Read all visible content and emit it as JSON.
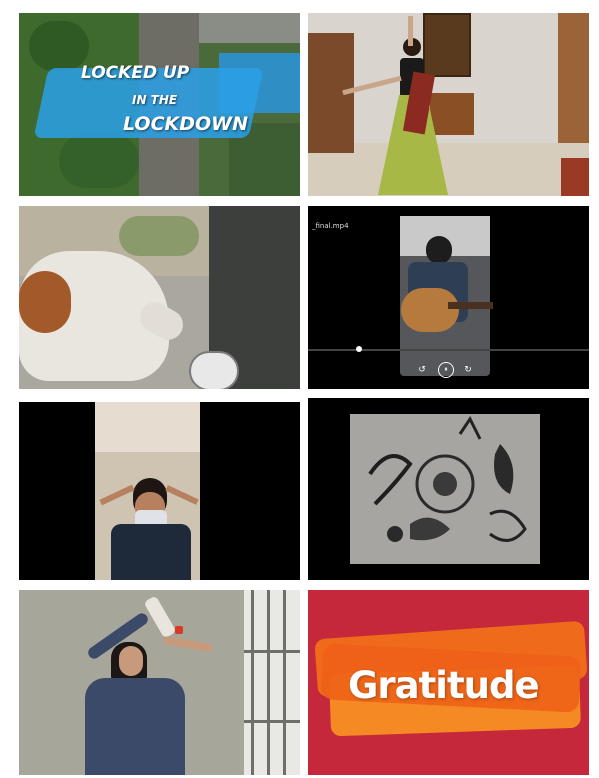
{
  "gallery": {
    "tile1": {
      "line1": "LOCKED UP",
      "line2": "IN THE",
      "line3": "LOCKDOWN"
    },
    "tile4": {
      "filename": "_final.mp4",
      "icon_rewind": "rewind-icon",
      "icon_pause": "pause-icon",
      "icon_forward": "forward-icon"
    },
    "tile8": {
      "word": "Gratitude"
    }
  },
  "colors": {
    "gratitude_bg": "#c4283a",
    "gratitude_brush": "#f06a1c",
    "blue_brush": "#2aa0e8"
  },
  "controls": {
    "rewind_glyph": "↺",
    "pause_glyph": "⏸",
    "forward_glyph": "↻"
  }
}
